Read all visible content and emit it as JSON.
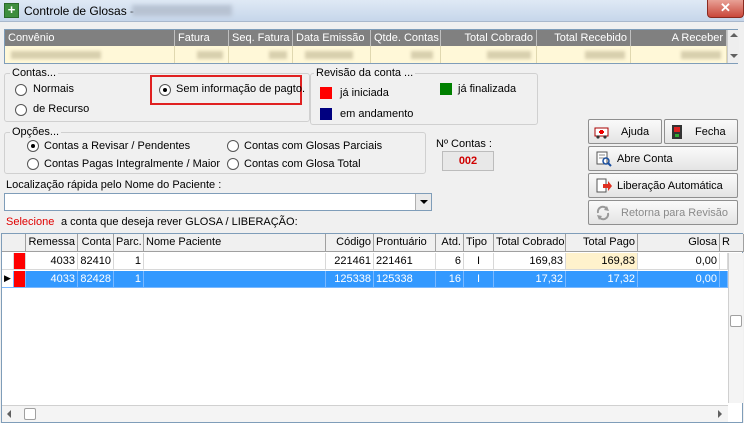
{
  "window": {
    "title": "Controle de Glosas -",
    "close_symbol": "✕",
    "app_icon_symbol": "+"
  },
  "top_grid": {
    "columns": [
      "Convênio",
      "Fatura",
      "Seq. Fatura",
      "Data Emissão",
      "Qtde. Contas",
      "Total Cobrado",
      "Total Recebido",
      "A Receber"
    ]
  },
  "contas_group": {
    "label": "Contas...",
    "options": {
      "normais": "Normais",
      "de_recurso": "de Recurso",
      "sem_informacao": "Sem informação de pagto."
    },
    "selected": "sem_informacao"
  },
  "revisao_group": {
    "label": "Revisão da conta ...",
    "legend": {
      "ja_iniciada": {
        "label": "já iniciada",
        "color": "#ff0000"
      },
      "em_andamento": {
        "label": "em andamento",
        "color": "#000080"
      },
      "ja_finalizada": {
        "label": "já finalizada",
        "color": "#008000"
      }
    }
  },
  "opcoes_group": {
    "label": "Opções...",
    "options": {
      "revisar_pendentes": "Contas a Revisar / Pendentes",
      "pagas_integralmente": "Contas Pagas Integralmente / Maior",
      "glosas_parciais": "Contas com Glosas Parciais",
      "glosa_total": "Contas com Glosa Total"
    },
    "selected": "revisar_pendentes"
  },
  "n_contas": {
    "label": "Nº Contas :",
    "value": "002"
  },
  "buttons": {
    "ajuda": "Ajuda",
    "fecha": "Fecha",
    "abre_conta": "Abre Conta",
    "liberacao_automatica": "Liberação Automática",
    "retorna_revisao": "Retorna para Revisão"
  },
  "search": {
    "label": "Localização rápida pelo Nome do Paciente :",
    "value": ""
  },
  "instruction": {
    "highlight": "Selecione",
    "rest": "a conta que deseja rever GLOSA / LIBERAÇÃO:"
  },
  "main_grid": {
    "columns": [
      "Remessa",
      "Conta",
      "Parc.",
      "Nome Paciente",
      "Código",
      "Prontuário",
      "Atd.",
      "Tipo",
      "Total Cobrado",
      "Total Pago",
      "Glosa",
      "R"
    ],
    "rows": [
      {
        "status_color": "#ff0000",
        "indicator": "",
        "remessa": "4033",
        "conta": "82410",
        "parc": "1",
        "nome": "",
        "codigo": "221461",
        "prontuario": "221461",
        "atd": "6",
        "tipo": "I",
        "total_cobrado": "169,83",
        "total_pago": "169,83",
        "glosa": "0,00",
        "selected": false
      },
      {
        "status_color": "#ff0000",
        "indicator": "▶",
        "remessa": "4033",
        "conta": "82428",
        "parc": "1",
        "nome": "",
        "codigo": "125338",
        "prontuario": "125338",
        "atd": "16",
        "tipo": "I",
        "total_cobrado": "17,32",
        "total_pago": "17,32",
        "glosa": "0,00",
        "selected": true
      }
    ]
  }
}
